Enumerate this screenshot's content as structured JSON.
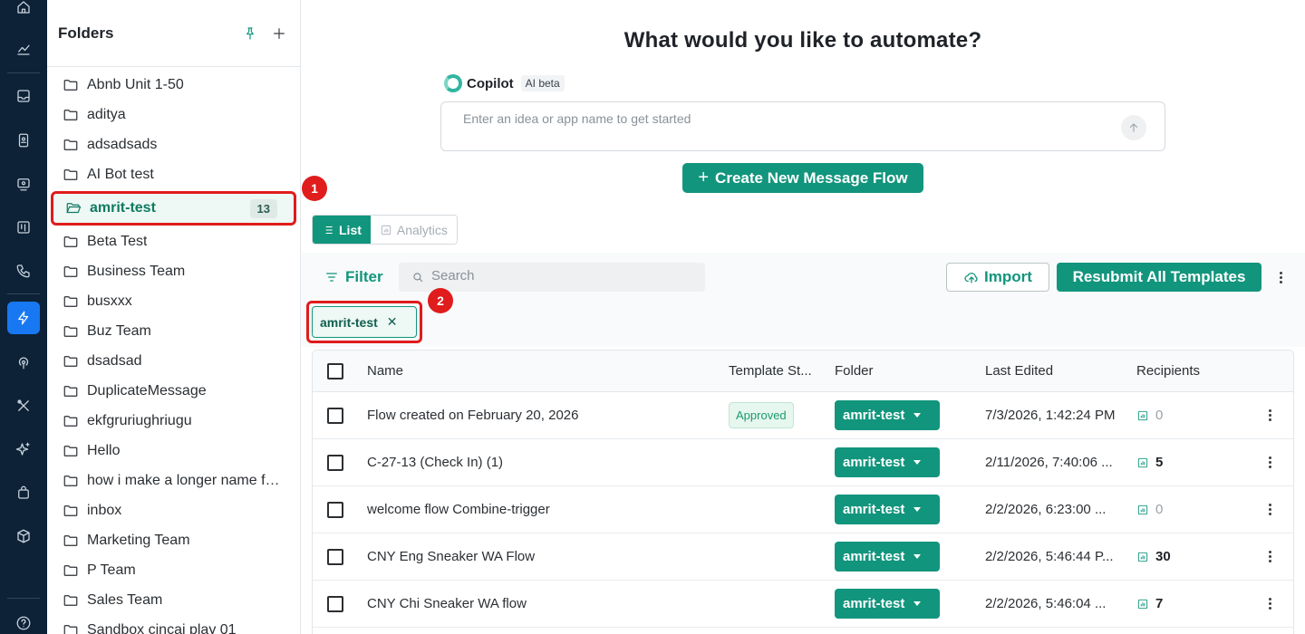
{
  "colors": {
    "rail_bg": "#0d2236",
    "rail_active": "#1778f2",
    "accent": "#12957d",
    "highlight_red": "#e01c1c"
  },
  "rail": {
    "icons": [
      "home-icon",
      "analytics-icon",
      "inbox-icon",
      "contacts-icon",
      "broadcast-icon",
      "board-icon",
      "phone-icon",
      "automation-icon",
      "signal-icon",
      "tools-icon",
      "ai-sparkle-icon",
      "store-icon",
      "package-icon",
      "help-icon"
    ],
    "active": "automation-icon"
  },
  "folders": {
    "title": "Folders",
    "items": [
      {
        "label": "Abnb Unit 1-50"
      },
      {
        "label": "aditya"
      },
      {
        "label": "adsadsads"
      },
      {
        "label": "AI Bot test"
      },
      {
        "label": "amrit-test",
        "count": "13",
        "active": true
      },
      {
        "label": "Beta Test"
      },
      {
        "label": "Business Team"
      },
      {
        "label": "busxxx"
      },
      {
        "label": "Buz Team"
      },
      {
        "label": "dsadsad"
      },
      {
        "label": "DuplicateMessage"
      },
      {
        "label": "ekfgruriughriugu"
      },
      {
        "label": "Hello"
      },
      {
        "label": "how i make a longer name for this folder"
      },
      {
        "label": "inbox"
      },
      {
        "label": "Marketing Team"
      },
      {
        "label": "P Team"
      },
      {
        "label": "Sales Team"
      },
      {
        "label": "Sandbox cincai play 01"
      }
    ]
  },
  "main": {
    "headline": "What would you like to automate?",
    "copilot": {
      "name": "Copilot",
      "tag": "AI beta",
      "placeholder": "Enter an idea or app name to get started"
    },
    "create_button": "Create New Message Flow",
    "views": {
      "list": "List",
      "analytics": "Analytics"
    },
    "toolbar": {
      "filter": "Filter",
      "search_placeholder": "Search",
      "import": "Import",
      "resubmit": "Resubmit All Templates"
    },
    "active_filter_chip": "amrit-test",
    "annotations": [
      "1",
      "2"
    ]
  },
  "table": {
    "columns": [
      "Name",
      "Template St...",
      "Folder",
      "Last Edited",
      "Recipients"
    ],
    "rows": [
      {
        "name": "Flow created on February 20, 2026",
        "status": "Approved",
        "folder": "amrit-test",
        "last_edited": "7/3/2026, 1:42:24 PM",
        "recipients": "0"
      },
      {
        "name": "C-27-13 (Check In) (1)",
        "status": "",
        "folder": "amrit-test",
        "last_edited": "2/11/2026, 7:40:06 ...",
        "recipients": "5"
      },
      {
        "name": "welcome flow Combine-trigger",
        "status": "",
        "folder": "amrit-test",
        "last_edited": "2/2/2026, 6:23:00 ...",
        "recipients": "0"
      },
      {
        "name": "CNY Eng Sneaker WA Flow",
        "status": "",
        "folder": "amrit-test",
        "last_edited": "2/2/2026, 5:46:44 P...",
        "recipients": "30"
      },
      {
        "name": "CNY Chi Sneaker WA flow",
        "status": "",
        "folder": "amrit-test",
        "last_edited": "2/2/2026, 5:46:04 ...",
        "recipients": "7"
      }
    ]
  }
}
